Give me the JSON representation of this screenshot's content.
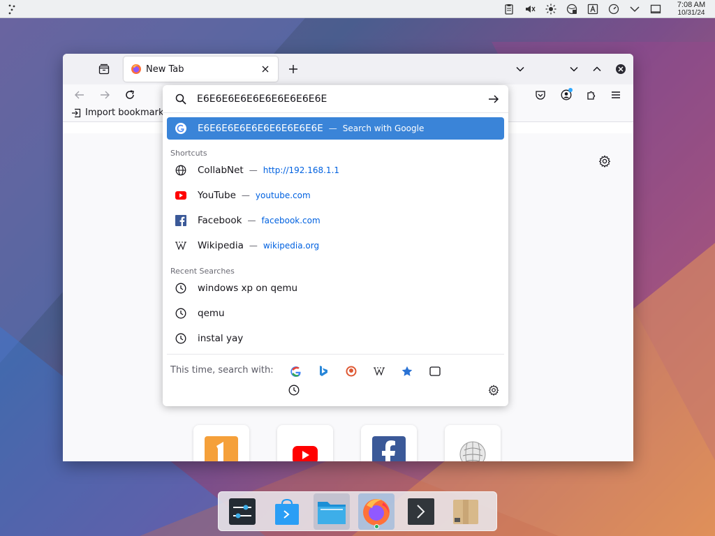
{
  "top_panel": {
    "clock_time": "7:08 AM",
    "clock_date": "10/31/24",
    "tray_icons": [
      "clipboard-icon",
      "mute-icon",
      "brightness-icon",
      "network-icon",
      "keyboard-layout-icon",
      "updates-icon",
      "chevron-down-icon",
      "show-desktop-icon"
    ]
  },
  "browser": {
    "tab_title": "New Tab",
    "bookmarks_bar": {
      "import_label": "Import bookmark"
    },
    "urlbar": {
      "input_value": "E6E6E6E6E6E6E6E6E6E6E",
      "suggestion": {
        "title": "E6E6E6E6E6E6E6E6E6E6E",
        "separator": "—",
        "action": "Search with Google"
      },
      "shortcuts_label": "Shortcuts",
      "shortcuts": [
        {
          "title": "CollabNet",
          "separator": "—",
          "url": "http://192.168.1.1",
          "icon": "globe-icon"
        },
        {
          "title": "YouTube",
          "separator": "—",
          "url": "youtube.com",
          "icon": "youtube-icon"
        },
        {
          "title": "Facebook",
          "separator": "—",
          "url": "facebook.com",
          "icon": "facebook-icon"
        },
        {
          "title": "Wikipedia",
          "separator": "—",
          "url": "wikipedia.org",
          "icon": "wikipedia-icon"
        }
      ],
      "recent_label": "Recent Searches",
      "recent": [
        {
          "title": "windows xp on qemu"
        },
        {
          "title": "qemu"
        },
        {
          "title": "instal yay"
        }
      ],
      "oneoff_label": "This time, search with:",
      "oneoff_engines": [
        "google-icon",
        "bing-icon",
        "duckduckgo-icon",
        "wikipedia-icon",
        "bookmarks-star-icon",
        "tabs-icon",
        "history-icon",
        "settings-gear-icon"
      ]
    },
    "top_sites": [
      "collabnet-icon",
      "youtube-icon",
      "facebook-icon",
      "wikipedia-icon"
    ]
  },
  "dock": {
    "items": [
      "system-settings",
      "discover-store",
      "file-manager",
      "firefox",
      "terminal",
      "archive-manager"
    ]
  },
  "colors": {
    "selected_row": "#3a84d8",
    "link_blue": "#0061e0",
    "panel_bg": "#eef0f2"
  }
}
